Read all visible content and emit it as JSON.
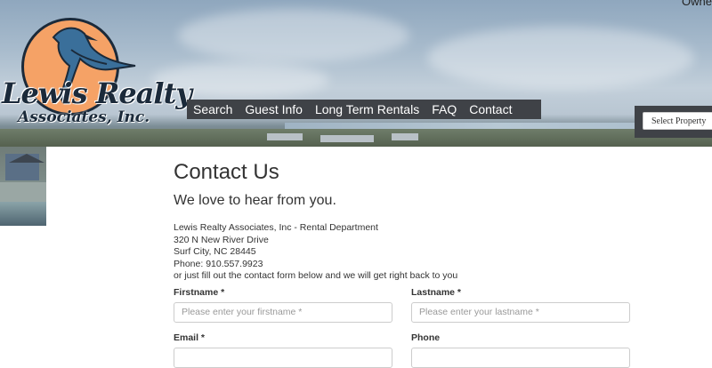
{
  "header": {
    "owner_text": "Owne",
    "logo": {
      "title": "Lewis Realty",
      "subtitle": "Associates, Inc."
    },
    "nav": [
      {
        "label": "Search"
      },
      {
        "label": "Guest Info"
      },
      {
        "label": "Long Term Rentals"
      },
      {
        "label": "FAQ"
      },
      {
        "label": "Contact"
      }
    ],
    "property_select": {
      "value": "Select Property"
    }
  },
  "main": {
    "title": "Contact Us",
    "subtitle": "We love to hear from you.",
    "address": [
      "Lewis Realty Associates, Inc - Rental Department",
      "320 N New River Drive",
      "Surf City, NC 28445",
      "Phone: 910.557.9923",
      "or just fill out the contact form below and we will get right back to you"
    ]
  },
  "form": {
    "firstname": {
      "label": "Firstname *",
      "placeholder": "Please enter your firstname *"
    },
    "lastname": {
      "label": "Lastname *",
      "placeholder": "Please enter your lastname *"
    },
    "email": {
      "label": "Email *",
      "placeholder": ""
    },
    "phone": {
      "label": "Phone",
      "placeholder": ""
    }
  },
  "colors": {
    "nav_bg": "#3f4247",
    "logo_sun": "#f5a266",
    "logo_ink": "#1b2a3a",
    "text": "#333333"
  }
}
